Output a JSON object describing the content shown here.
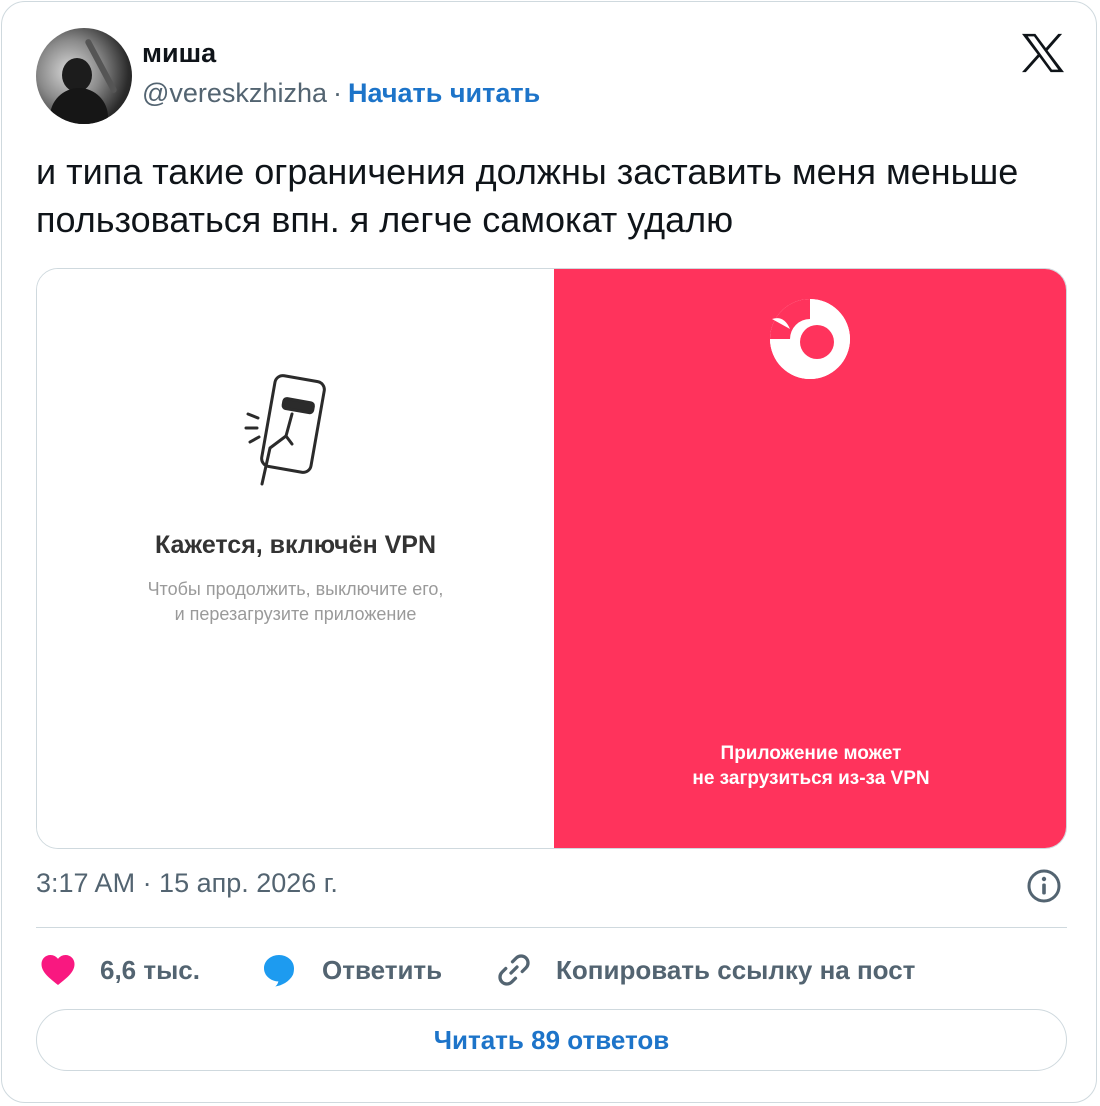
{
  "author": {
    "name": "миша",
    "handle": "@vereskzhizha",
    "separator": "·",
    "follow_label": "Начать читать"
  },
  "tweet": {
    "text": "и типа такие ограничения должны заставить меня меньше пользоваться впн. я легче самокат удалю",
    "timestamp": "3:17 AM · 15 апр. 2026 г."
  },
  "media": {
    "left": {
      "title": "Кажется, включён VPN",
      "subtitle_line1": "Чтобы продолжить, выключите его,",
      "subtitle_line2": "и перезагрузите приложение",
      "background": "#ffffff"
    },
    "right": {
      "message_line1": "Приложение может",
      "message_line2": "не загрузиться из-за VPN",
      "background": "#ff335c"
    }
  },
  "actions": {
    "like_count": "6,6 тыс.",
    "reply_label": "Ответить",
    "copy_link_label": "Копировать ссылку на пост"
  },
  "replies_button_label": "Читать 89 ответов",
  "icons": [
    "x-logo-icon",
    "heart-icon",
    "reply-bubble-icon",
    "link-icon",
    "info-icon",
    "phone-illustration-icon",
    "app-logo-icon"
  ],
  "colors": {
    "link_blue": "#1d74c9",
    "like_pink": "#f91880",
    "reply_blue": "#1d9bf0",
    "muted_text": "#536471",
    "app_red": "#ff335c"
  }
}
